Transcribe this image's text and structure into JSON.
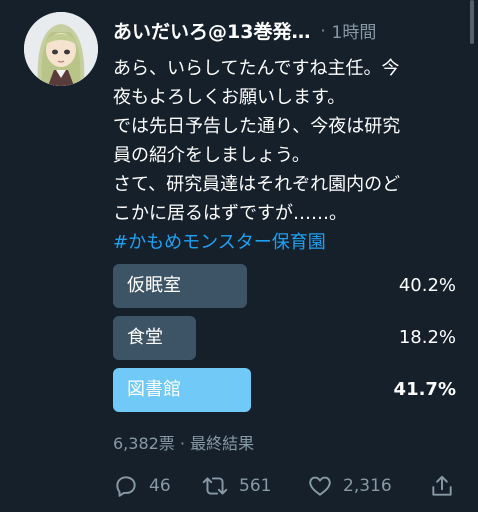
{
  "tweet": {
    "author_name": "あいだいろ@13巻発…",
    "separator": "·",
    "timestamp": "1時間",
    "text_lines": [
      "あら、いらしてたんですね主任。今",
      "夜もよろしくお願いします。",
      "では先日予告した通り、今夜は研究",
      "員の紹介をしましょう。",
      "さて、研究員達はそれぞれ園内のど",
      "こかに居るはずですが……。"
    ],
    "hashtag": "#かもめモンスター保育園"
  },
  "poll": {
    "options": [
      {
        "label": "仮眠室",
        "percent_text": "40.2%",
        "percent": 40.2,
        "winner": false
      },
      {
        "label": "食堂",
        "percent_text": "18.2%",
        "percent": 18.2,
        "winner": false
      },
      {
        "label": "図書館",
        "percent_text": "41.7%",
        "percent": 41.7,
        "winner": true
      }
    ],
    "meta": "6,382票 · 最終結果"
  },
  "actions": {
    "replies": "46",
    "retweets": "561",
    "likes": "2,316"
  },
  "colors": {
    "background": "#15202b",
    "bar": "#3d5466",
    "winner_bar": "#71c9f8",
    "hashtag": "#1da1f2",
    "muted": "#8899a6"
  },
  "icons": {
    "reply": "reply-icon",
    "retweet": "retweet-icon",
    "like": "heart-icon",
    "share": "share-icon"
  }
}
